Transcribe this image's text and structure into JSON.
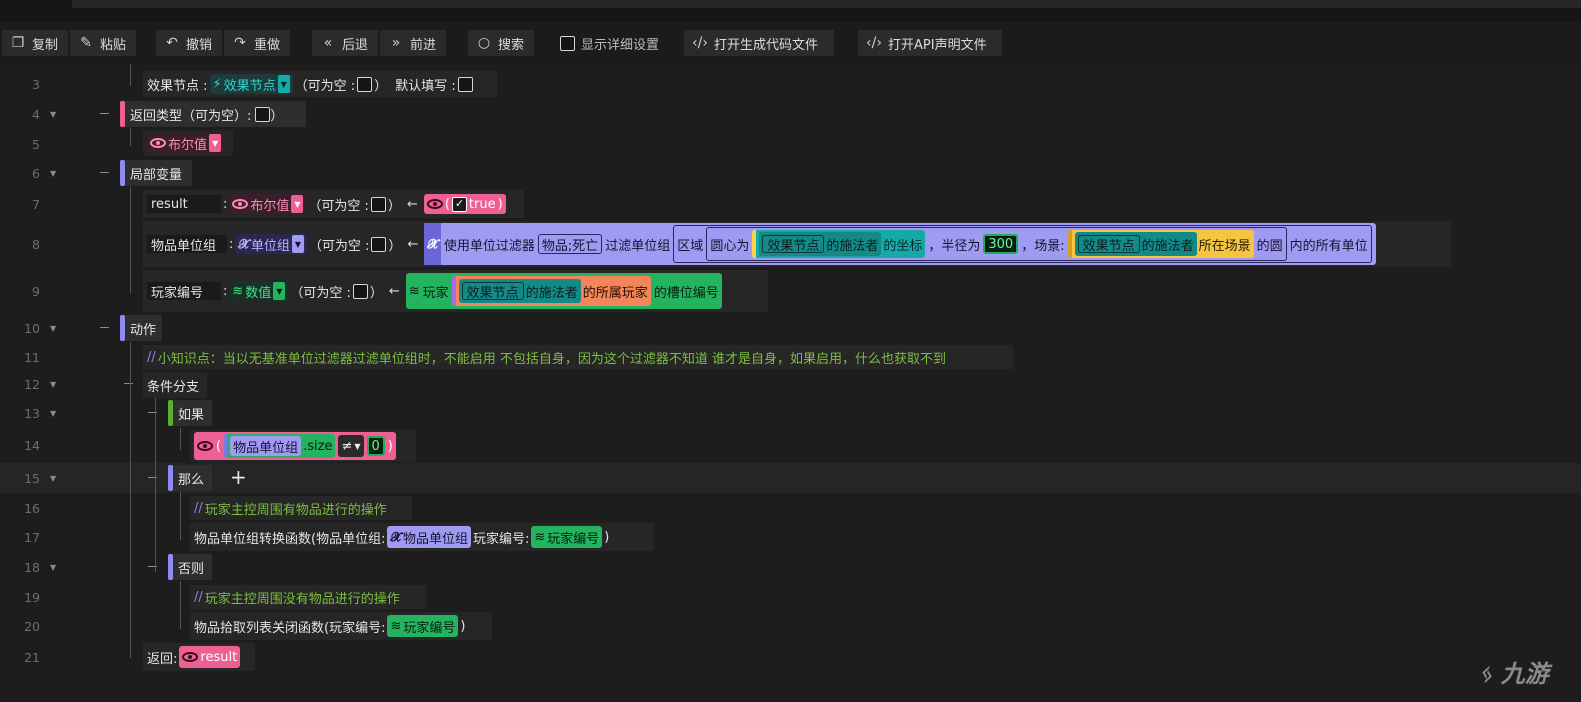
{
  "toolbar": {
    "copy": "复制",
    "paste": "粘贴",
    "undo": "撤销",
    "redo": "重做",
    "back": "后退",
    "forward": "前进",
    "search": "搜索",
    "show_details": "显示详细设置",
    "open_generated": "打开生成代码文件",
    "open_api": "打开API声明文件"
  },
  "line_numbers": [
    "3",
    "4",
    "5",
    "6",
    "7",
    "8",
    "9",
    "10",
    "11",
    "12",
    "13",
    "14",
    "15",
    "16",
    "17",
    "18",
    "19",
    "20",
    "21"
  ],
  "rows": {
    "r3": {
      "label": "效果节点 :",
      "node": "效果节点",
      "nullable": "（可为空 :",
      "close": "）",
      "default_fill": "默认填写 :"
    },
    "r4": {
      "label": "返回类型（可为空）:",
      "close": "）"
    },
    "r5": {
      "type": "布尔值"
    },
    "r6": {
      "label": "局部变量"
    },
    "r7": {
      "name": "result",
      "colon": ":",
      "type": "布尔值",
      "nullable": "（可为空 :",
      "close": "）",
      "arrow": "←",
      "paren_open": "(",
      "value": "true",
      "paren_close": ")"
    },
    "r8": {
      "name": "物品单位组",
      "colon": ":",
      "type": "单位组",
      "nullable": "（可为空 :",
      "close": "）",
      "arrow": "←",
      "t1": "使用单位过滤器",
      "filter": "物品;死亡",
      "t2": "过滤单位组",
      "area": "区域",
      "center": "圆心为",
      "node": "效果节点",
      "caster": "的施法者",
      "coord": "的坐标",
      "radius_label": "，半径为",
      "radius": "300",
      "scene_label": "，场景:",
      "scene_node": "效果节点",
      "scene_caster": "的施法者",
      "scene_of": "所在场景",
      "circle": "的圆",
      "all_units": "内的所有单位"
    },
    "r9": {
      "name": "玩家编号",
      "colon": ":",
      "type": "数值",
      "nullable": "（可为空 :",
      "close": "）",
      "arrow": "←",
      "player": "玩家",
      "node": "效果节点",
      "caster": "的施法者",
      "owner": "的所属玩家",
      "slot": "的槽位编号"
    },
    "r10": {
      "label": "动作"
    },
    "r11": {
      "slashes": "//",
      "comment": "小知识点：当以无基准单位过滤器过滤单位组时，不能启用 不包括自身，因为这个过滤器不知道 谁才是自身，如果启用，什么也获取不到"
    },
    "r12": {
      "label": "条件分支"
    },
    "r13": {
      "label": "如果"
    },
    "r14": {
      "paren_open": "(",
      "var": "物品单位组",
      "size": ".size",
      "op": "≠",
      "value": "0",
      "paren_close": ")"
    },
    "r15": {
      "label": "那么",
      "plus": "+"
    },
    "r16": {
      "slashes": "//",
      "comment": "玩家主控周围有物品进行的操作"
    },
    "r17": {
      "func": "物品单位组转换函数(物品单位组:",
      "arg1": "物品单位组",
      "label2": "玩家编号:",
      "arg2": "玩家编号",
      "close": ")"
    },
    "r18": {
      "label": "否则"
    },
    "r19": {
      "slashes": "//",
      "comment": "玩家主控周围没有物品进行的操作"
    },
    "r20": {
      "func": "物品拾取列表关闭函数(玩家编号:",
      "arg": "玩家编号",
      "close": ")"
    },
    "r21": {
      "label": "返回:",
      "value": "result"
    }
  },
  "watermark": "九游",
  "colors": {
    "bool": "#ee5f94",
    "node": "#17a9a6",
    "unitgroup": "#a09bf2",
    "number": "#24b35f",
    "player": "#f2855a",
    "scene": "#f5c542",
    "comment": "#7cbf3f"
  }
}
